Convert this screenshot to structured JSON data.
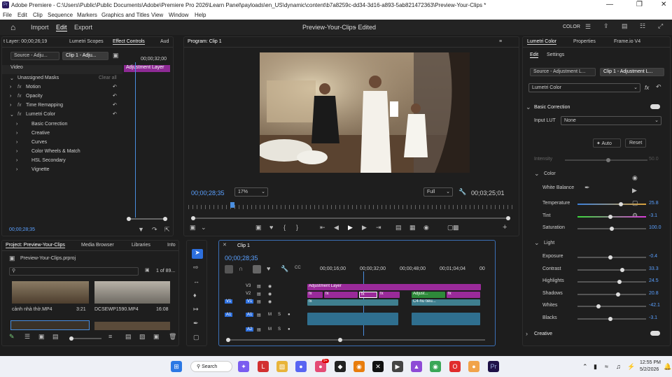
{
  "window": {
    "title": "Adobe Premiere - C:\\Users\\Public\\Public Documents\\Adobe\\Premiere Pro 2026\\Learn Panel\\payloads\\en_US\\dynamic\\content\\b7a8259c-dd34-3d16-a893-5ab821472363\\Preview-Your-Clips *"
  },
  "menu": [
    "File",
    "Edit",
    "Clip",
    "Sequence",
    "Markers",
    "Graphics and Titles",
    "View",
    "Window",
    "Help"
  ],
  "workspace": {
    "import": "Import",
    "edit": "Edit",
    "export": "Export",
    "project_title": "Preview-Your-Clips",
    "status": "- Edited",
    "color_label": "COLOR"
  },
  "source_panel": {
    "layer_label": "t Layer: 00;00;26;19",
    "tabs": [
      "Lumetri Scopes",
      "Effect Controls",
      "Aud"
    ],
    "source_chip": "Source - Adju...",
    "clip_chip": "Clip 1 - Adju...",
    "timecode_head": "00;00;32;00",
    "adj_bar": "Adjustment Layer",
    "section": "Video",
    "masks": "Unassigned Masks",
    "clear_all": "Clear all",
    "items": [
      "Motion",
      "Opacity",
      "Time Remapping",
      "Lumetri Color"
    ],
    "subitems": [
      "Basic Correction",
      "Creative",
      "Curves",
      "Color Wheels & Match",
      "HSL Secondary",
      "Vignette"
    ],
    "bottom_tc": "00;00;28;35"
  },
  "program": {
    "tab": "Program: Clip 1",
    "timecode": "00;00;28;35",
    "zoom": "17%",
    "quality": "Full",
    "duration": "00;03;25;01"
  },
  "project": {
    "tabs": [
      "Project: Preview-Your-Clips",
      "Media Browser",
      "Libraries",
      "Info"
    ],
    "file": "Preview-Your-Clips.prproj",
    "count": "1 of 89...",
    "clips": [
      {
        "name": "cảnh nhà thờ.MP4",
        "dur": "3:21"
      },
      {
        "name": "DCSEWP1590.MP4",
        "dur": "16:08"
      }
    ]
  },
  "timeline": {
    "tab": "Clip 1",
    "timecode": "00;00;28;35",
    "ruler": [
      "00;00;16;00",
      "00;00;32;00",
      "00;00;48;00",
      "00;01;04;04",
      "00"
    ],
    "tracks": [
      "V3",
      "V2",
      "V1",
      "A1",
      "A2"
    ],
    "adj_clip": "Adjustment Layer",
    "clip_a": "Adjust...",
    "clip_b": "C4-hũ tiếu..."
  },
  "lumetri": {
    "tab": "Lumetri Color",
    "tabs2": [
      "Properties",
      "Frame.io V4"
    ],
    "subtabs": [
      "Edit",
      "Settings"
    ],
    "source_chip": "Source - Adjustment L...",
    "clip_chip": "Clip 1 - Adjustment L...",
    "effect": "Lumetri Color",
    "basic": "Basic Correction",
    "input_lut_label": "Input LUT",
    "input_lut": "None",
    "auto": "Auto",
    "reset": "Reset",
    "intensity_label": "Intensity",
    "intensity_val": "50.0",
    "color_head": "Color",
    "wb": "White Balance",
    "light_head": "Light",
    "creative": "Creative",
    "color_sliders": [
      {
        "label": "Temperature",
        "value": "25.8",
        "pos": 0.64
      },
      {
        "label": "Tint",
        "value": "-3.1",
        "pos": 0.48
      },
      {
        "label": "Saturation",
        "value": "100.0",
        "pos": 0.5
      }
    ],
    "light_sliders": [
      {
        "label": "Exposure",
        "value": "-0.4",
        "pos": 0.48
      },
      {
        "label": "Contrast",
        "value": "33.3",
        "pos": 0.66
      },
      {
        "label": "Highlights",
        "value": "24.5",
        "pos": 0.62
      },
      {
        "label": "Shadows",
        "value": "20.8",
        "pos": 0.6
      },
      {
        "label": "Whites",
        "value": "-42.1",
        "pos": 0.29
      },
      {
        "label": "Blacks",
        "value": "-3.1",
        "pos": 0.48
      }
    ]
  },
  "taskbar": {
    "search": "Search",
    "time": "12:55 PM",
    "date": "5/2/2026",
    "badge": "9+"
  },
  "colors": {
    "accent": "#2d8ceb",
    "adj_clip": "#9a2a9a",
    "video_clip": "#3f7f8f",
    "audio_clip": "#2f6f8f"
  }
}
